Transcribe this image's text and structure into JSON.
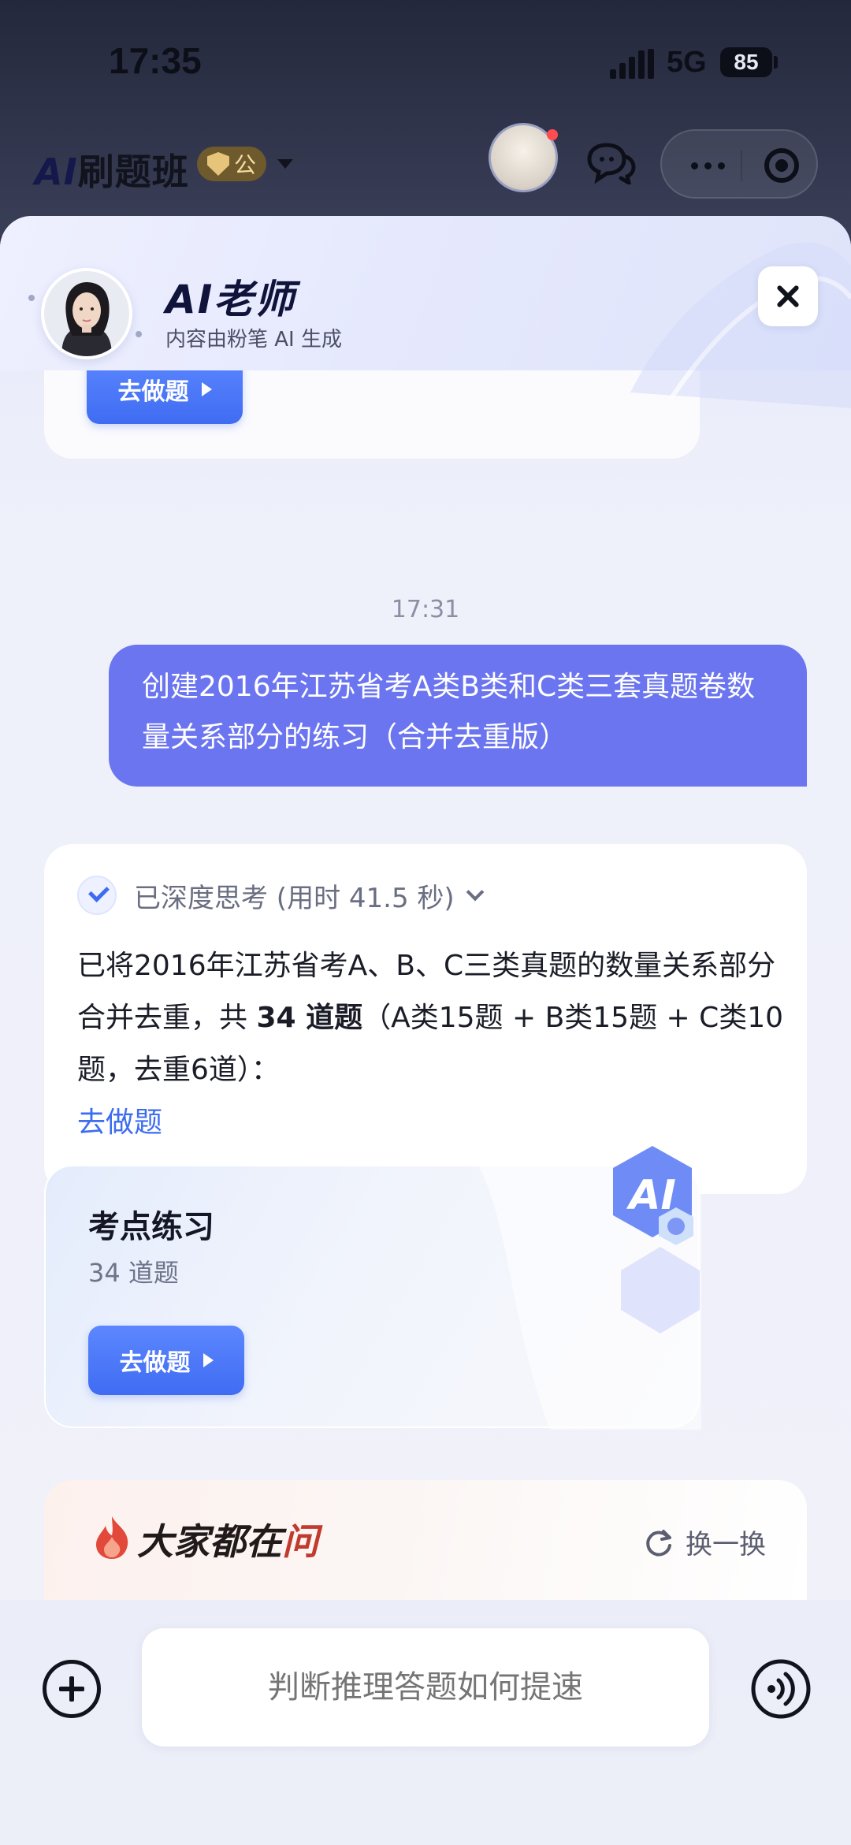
{
  "status_bar": {
    "time": "17:35",
    "network": "5G",
    "battery": "85"
  },
  "app_header": {
    "title_ai": "AI",
    "title_rest": "刷题班",
    "badge_text": "公"
  },
  "sheet_header": {
    "name": "AI老师",
    "subtitle": "内容由粉笔 AI 生成"
  },
  "chat": {
    "prev_card_button": "去做题",
    "timestamp": "17:31",
    "user_message": "创建2016年江苏省考A类B类和C类三套真题卷数量关系部分的练习（合并去重版）",
    "ai_think_label": "已深度思考 (用时 41.5 秒)",
    "ai_text_before": "已将2016年江苏省考A、B、C三类真题的数量关系部分合并去重，共 ",
    "ai_text_bold": "34 道题",
    "ai_text_after": "（A类15题 + B类15题 + C类10题，去重6道）：",
    "ai_link": "去做题",
    "practice_card": {
      "title": "考点练习",
      "count": "34 道题",
      "button": "去做题",
      "hex_label": "AI"
    },
    "ask_section": {
      "title_part1": "大家都在",
      "title_part2": "问",
      "refresh_label": "换一换"
    }
  },
  "input": {
    "placeholder": "判断推理答题如何提速"
  },
  "colors": {
    "user_bubble": "#6b75f0",
    "primary_button": "#4a78f7",
    "link": "#3d6cf0",
    "accent_red": "#c23a2e"
  },
  "icons": [
    "signal-icon",
    "chat-bubbles-icon",
    "more-icon",
    "close-mini-icon",
    "close-icon",
    "check-icon",
    "chevron-down-icon",
    "play-icon",
    "flame-icon",
    "refresh-icon",
    "plus-icon",
    "voice-icon"
  ]
}
